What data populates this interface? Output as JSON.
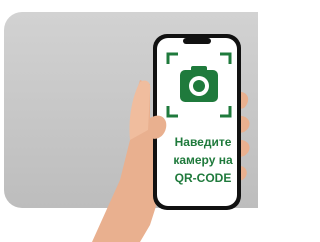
{
  "instruction": {
    "lines": [
      "Наведите",
      "камеру на",
      "QR-CODE"
    ]
  },
  "colors": {
    "accent_green": "#1f7a3c",
    "card_gray": "#c8c8c8",
    "phone_black": "#111111",
    "skin": "#e9b08f"
  },
  "icons": {
    "camera": "camera-icon",
    "scan_frame": "scan-frame-icon"
  }
}
